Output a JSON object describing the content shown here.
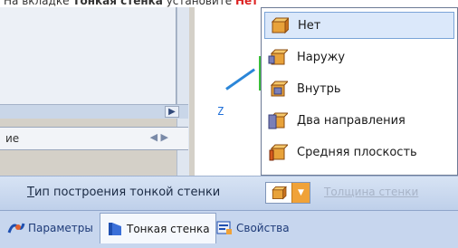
{
  "caption": {
    "prefix": "На вкладке ",
    "bold": "Тонкая стенка",
    "middle": " установите ",
    "red": "Нет"
  },
  "left_panel": {
    "tab_label": "ие",
    "arrows": "◀ ▶",
    "scroll_arrow": "▶"
  },
  "viewport": {
    "axis_label": "Z"
  },
  "menu": {
    "items": [
      {
        "label": "Нет",
        "icon": "box-none-icon",
        "selected": true
      },
      {
        "label": "Наружу",
        "icon": "box-outward-icon",
        "selected": false
      },
      {
        "label": "Внутрь",
        "icon": "box-inward-icon",
        "selected": false
      },
      {
        "label": "Два направления",
        "icon": "box-two-way-icon",
        "selected": false
      },
      {
        "label": "Средняя плоскость",
        "icon": "box-midplane-icon",
        "selected": false
      }
    ]
  },
  "toolbar": {
    "label_first": "Т",
    "label_rest": "ип построения тонкой стенки",
    "disabled_text": "Толщина стенки"
  },
  "tabs": [
    {
      "label": "Параметры",
      "icon": "parameters-icon",
      "active": false
    },
    {
      "label": "Тонкая стенка",
      "icon": "thin-wall-icon",
      "active": true
    },
    {
      "label": "Свойства",
      "icon": "properties-icon",
      "active": false
    }
  ]
}
